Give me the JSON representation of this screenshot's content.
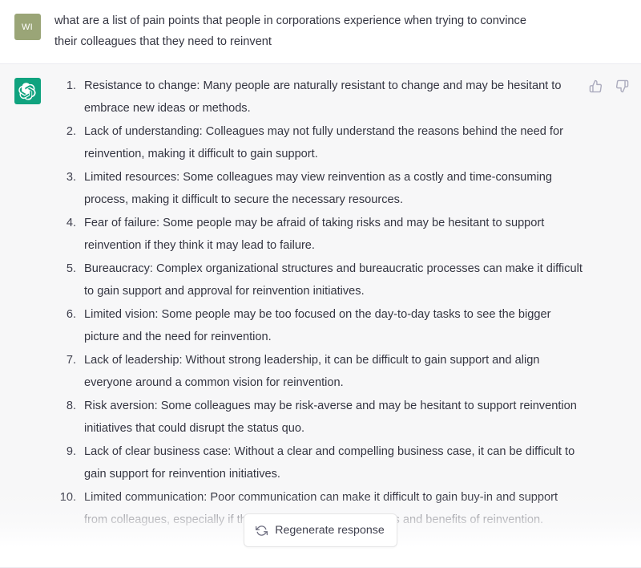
{
  "conversation": {
    "user_message": {
      "avatar_initials": "WI",
      "avatar_color": "#9aa577",
      "text": "what are a list of pain points that people in corporations experience when trying to convince their colleagues that they need to reinvent"
    },
    "assistant_message": {
      "avatar_icon": "openai-logo-icon",
      "avatar_color": "#10a37f",
      "list_items": [
        "Resistance to change: Many people are naturally resistant to change and may be hesitant to embrace new ideas or methods.",
        "Lack of understanding: Colleagues may not fully understand the reasons behind the need for reinvention, making it difficult to gain support.",
        "Limited resources: Some colleagues may view reinvention as a costly and time-consuming process, making it difficult to secure the necessary resources.",
        "Fear of failure: Some people may be afraid of taking risks and may be hesitant to support reinvention if they think it may lead to failure.",
        "Bureaucracy: Complex organizational structures and bureaucratic processes can make it difficult to gain support and approval for reinvention initiatives.",
        "Limited vision: Some people may be too focused on the day-to-day tasks to see the bigger picture and the need for reinvention.",
        "Lack of leadership: Without strong leadership, it can be difficult to gain support and align everyone around a common vision for reinvention.",
        "Risk aversion: Some colleagues may be risk-averse and may be hesitant to support reinvention initiatives that could disrupt the status quo.",
        "Lack of clear business case: Without a clear and compelling business case, it can be difficult to gain support for reinvention initiatives.",
        "Limited communication: Poor communication can make it difficult to gain buy-in and support from colleagues, especially if they don't understand the goals and benefits of reinvention."
      ],
      "feedback": {
        "thumbs_up_icon": "thumbs-up-icon",
        "thumbs_down_icon": "thumbs-down-icon"
      }
    }
  },
  "footer": {
    "regenerate_label": "Regenerate response",
    "regenerate_icon": "refresh-icon"
  }
}
